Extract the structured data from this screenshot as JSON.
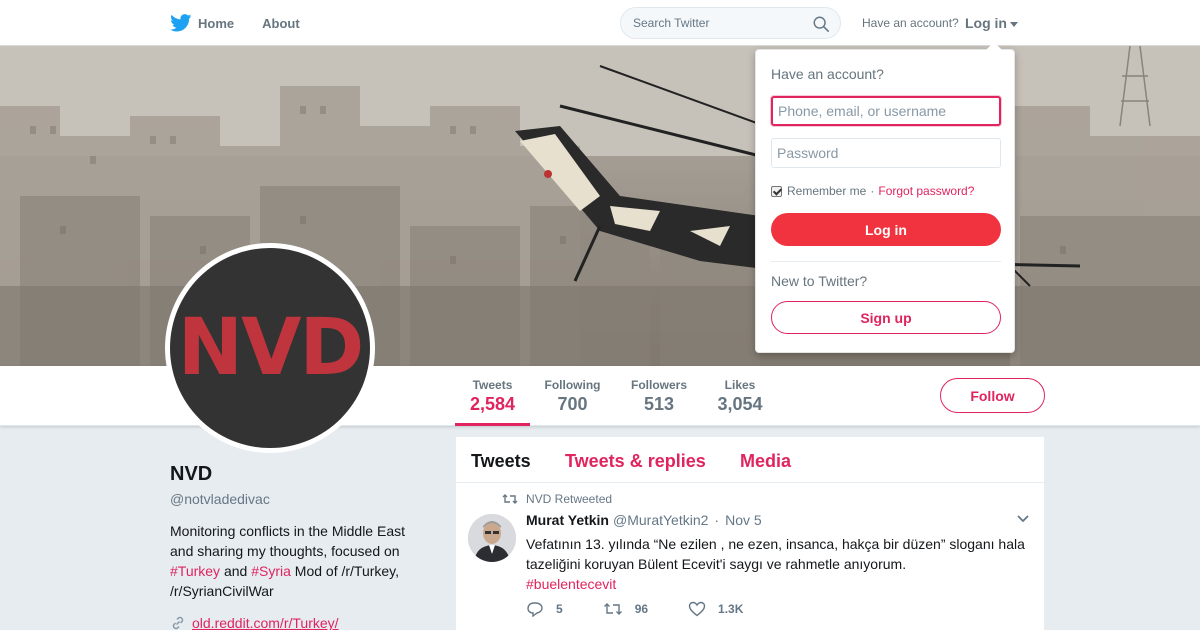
{
  "nav": {
    "home_label": "Home",
    "about_label": "About",
    "search_placeholder": "Search Twitter",
    "have_account_label": "Have an account?",
    "login_label": "Log in"
  },
  "profile": {
    "name": "NVD",
    "handle": "@notvladedivac",
    "avatar_text": "NVD",
    "bio_prefix": "Monitoring conflicts in the Middle East and sharing my thoughts, focused on ",
    "bio_tag1": "#Turkey",
    "bio_and": " and ",
    "bio_tag2": "#Syria",
    "bio_suffix": " Mod of /r/Turkey, /r/SyrianCivilWar",
    "link": "old.reddit.com/r/Turkey/"
  },
  "stats": [
    {
      "label": "Tweets",
      "value": "2,584",
      "active": true
    },
    {
      "label": "Following",
      "value": "700",
      "active": false
    },
    {
      "label": "Followers",
      "value": "513",
      "active": false
    },
    {
      "label": "Likes",
      "value": "3,054",
      "active": false
    }
  ],
  "follow_label": "Follow",
  "timeline": {
    "tabs": [
      "Tweets",
      "Tweets & replies",
      "Media"
    ],
    "tweet": {
      "retweet_context": "NVD Retweeted",
      "author_name": "Murat Yetkin",
      "author_handle": "@MuratYetkin2",
      "separator": "·",
      "date": "Nov 5",
      "text": "Vefatının 13. yılında “Ne ezilen , ne ezen, insanca, hakça bir düzen” sloganı hala tazeliğini koruyan Bülent Ecevit'i saygı ve rahmetle anıyorum.",
      "hashtag": "#buelentecevit",
      "replies": "5",
      "retweets": "96",
      "likes": "1.3K"
    }
  },
  "login_dropdown": {
    "title": "Have an account?",
    "username_placeholder": "Phone, email, or username",
    "password_placeholder": "Password",
    "remember_label": "Remember me",
    "separator": "·",
    "forgot_label": "Forgot password?",
    "login_button": "Log in",
    "new_label": "New to Twitter?",
    "signup_button": "Sign up"
  },
  "colors": {
    "accent": "#e0245e",
    "twitter_blue": "#1da1f2",
    "avatar_bg": "#333333",
    "avatar_text": "#c0353d"
  },
  "icons": [
    "twitter-bird-icon",
    "search-icon",
    "caret-down-icon",
    "link-icon",
    "retweet-icon",
    "reply-icon",
    "like-icon",
    "chevron-down-icon"
  ]
}
